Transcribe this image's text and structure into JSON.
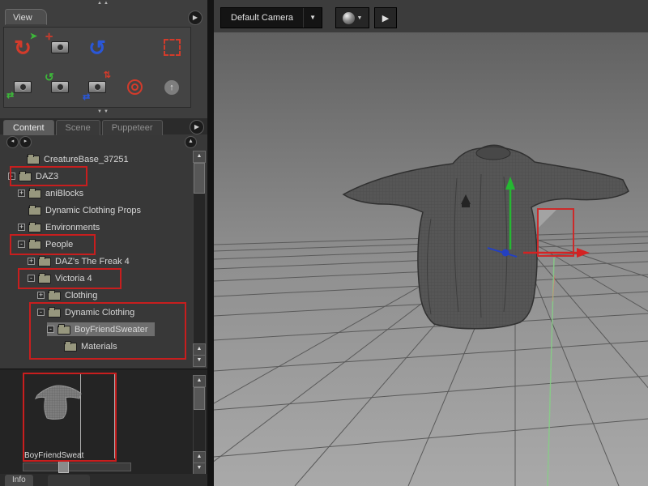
{
  "colors": {
    "annotation": "#c81e1e",
    "axis_x": "#d42222",
    "axis_y": "#25b832",
    "axis_z": "#2440c0",
    "selection_bg": "#6e6e6e"
  },
  "view_panel": {
    "tab": "View"
  },
  "content_panel": {
    "tabs": [
      {
        "label": "Content",
        "active": true
      },
      {
        "label": "Scene",
        "active": false
      },
      {
        "label": "Puppeteer",
        "active": false
      }
    ],
    "tree": [
      {
        "label": "CreatureBase_37251",
        "glyph": ""
      },
      {
        "label": "DAZ3",
        "glyph": "-"
      },
      {
        "label": "aniBlocks",
        "glyph": "+"
      },
      {
        "label": "Dynamic Clothing Props",
        "glyph": ""
      },
      {
        "label": "Environments",
        "glyph": "+"
      },
      {
        "label": "People",
        "glyph": "-"
      },
      {
        "label": "DAZ's The Freak 4",
        "glyph": "+"
      },
      {
        "label": "Victoria 4",
        "glyph": "-"
      },
      {
        "label": "Clothing",
        "glyph": "+"
      },
      {
        "label": "Dynamic Clothing",
        "glyph": "-"
      },
      {
        "label": "BoyFriendSweater",
        "glyph": "-",
        "selected": true
      },
      {
        "label": "Materials",
        "glyph": ""
      }
    ]
  },
  "preview": {
    "caption": "BoyFriendSweat"
  },
  "bottom_tabs": [
    {
      "label": "Info"
    },
    {
      "label": ""
    }
  ],
  "viewport": {
    "camera": "Default Camera",
    "dropdown_icon": "▼",
    "play_icon": "▶"
  }
}
